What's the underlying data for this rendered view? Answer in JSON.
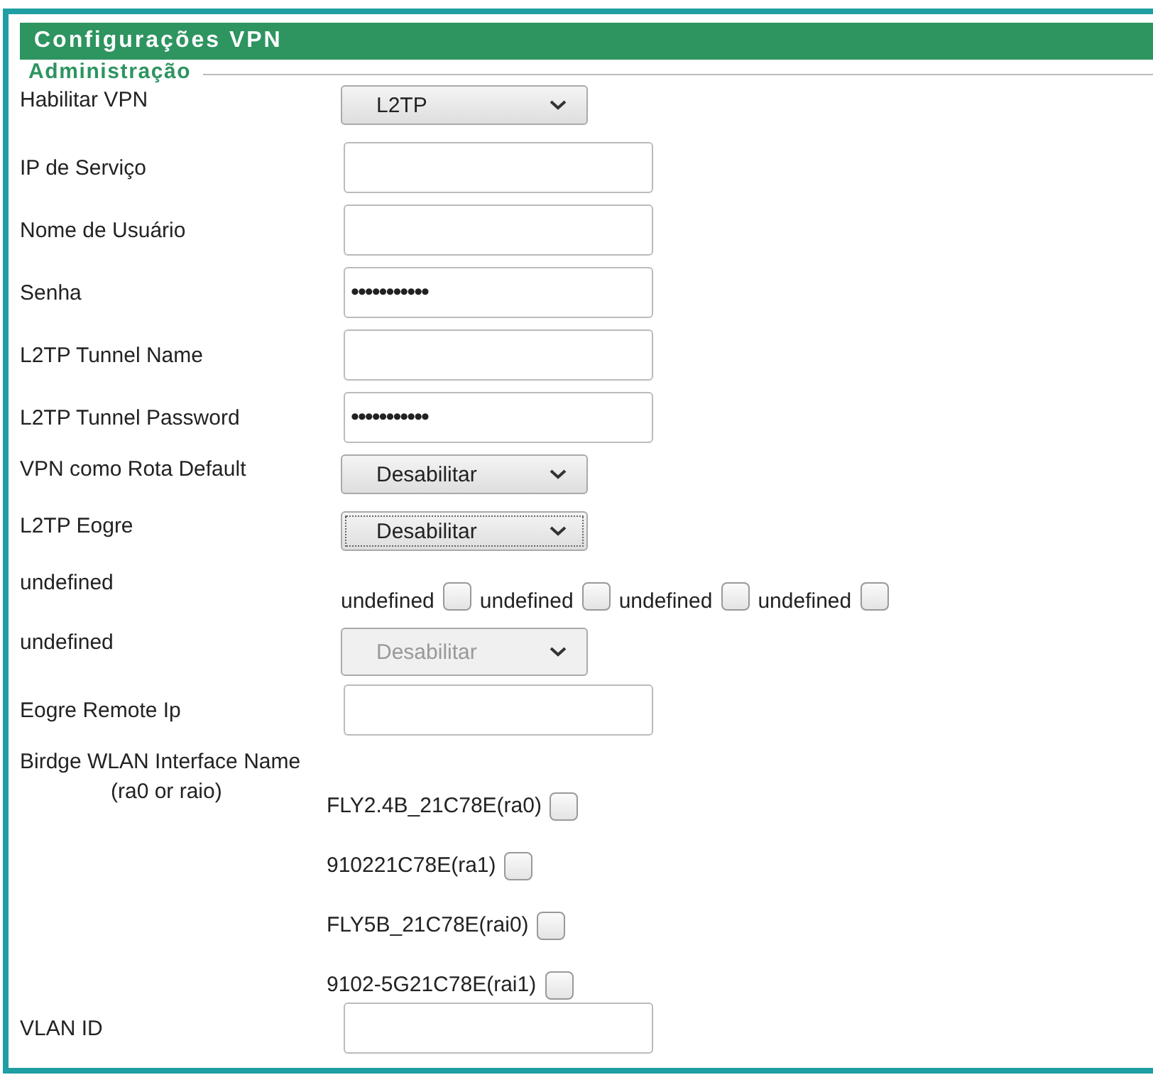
{
  "header": {
    "title": "Configurações VPN"
  },
  "section": {
    "legend": "Administração"
  },
  "rows": [
    {
      "kind": "select",
      "label": "Habilitar VPN",
      "value": "L2TP",
      "disabled": false,
      "focused": false
    },
    {
      "kind": "input",
      "label": "IP de Serviço"
    },
    {
      "kind": "input",
      "label": "Nome de Usuário"
    },
    {
      "kind": "input",
      "label": "Senha",
      "value": "•••••••••••"
    },
    {
      "kind": "input",
      "label": "L2TP Tunnel Name"
    },
    {
      "kind": "input",
      "label": "L2TP Tunnel Password",
      "value": "•••••••••••"
    },
    {
      "kind": "select",
      "label": "VPN como Rota Default",
      "value": "Desabilitar",
      "disabled": false,
      "focused": false
    },
    {
      "kind": "select",
      "label": "L2TP Eogre",
      "value": "Desabilitar",
      "disabled": false,
      "focused": true
    },
    {
      "kind": "checks",
      "label": "undefined",
      "options": [
        {
          "label": "undefined",
          "checked": false
        },
        {
          "label": "undefined",
          "checked": false
        },
        {
          "label": "undefined",
          "checked": false
        },
        {
          "label": "undefined",
          "checked": false
        }
      ]
    },
    {
      "kind": "select",
      "label": "undefined",
      "value": "Desabilitar",
      "disabled": true,
      "focused": false
    },
    {
      "kind": "input",
      "label": "Eogre Remote Ip"
    },
    {
      "kind": "wlan",
      "label": "Birdge WLAN Interface Name",
      "note": "(ra0 or raio)",
      "options": [
        {
          "label": "FLY2.4B_21C78E(ra0)",
          "checked": false
        },
        {
          "label": "910221C78E(ra1)",
          "checked": false
        },
        {
          "label": "FLY5B_21C78E(rai0)",
          "checked": false
        },
        {
          "label": "9102-5G21C78E(rai1)",
          "checked": false
        }
      ]
    },
    {
      "kind": "input",
      "label": "VLAN ID"
    }
  ]
}
